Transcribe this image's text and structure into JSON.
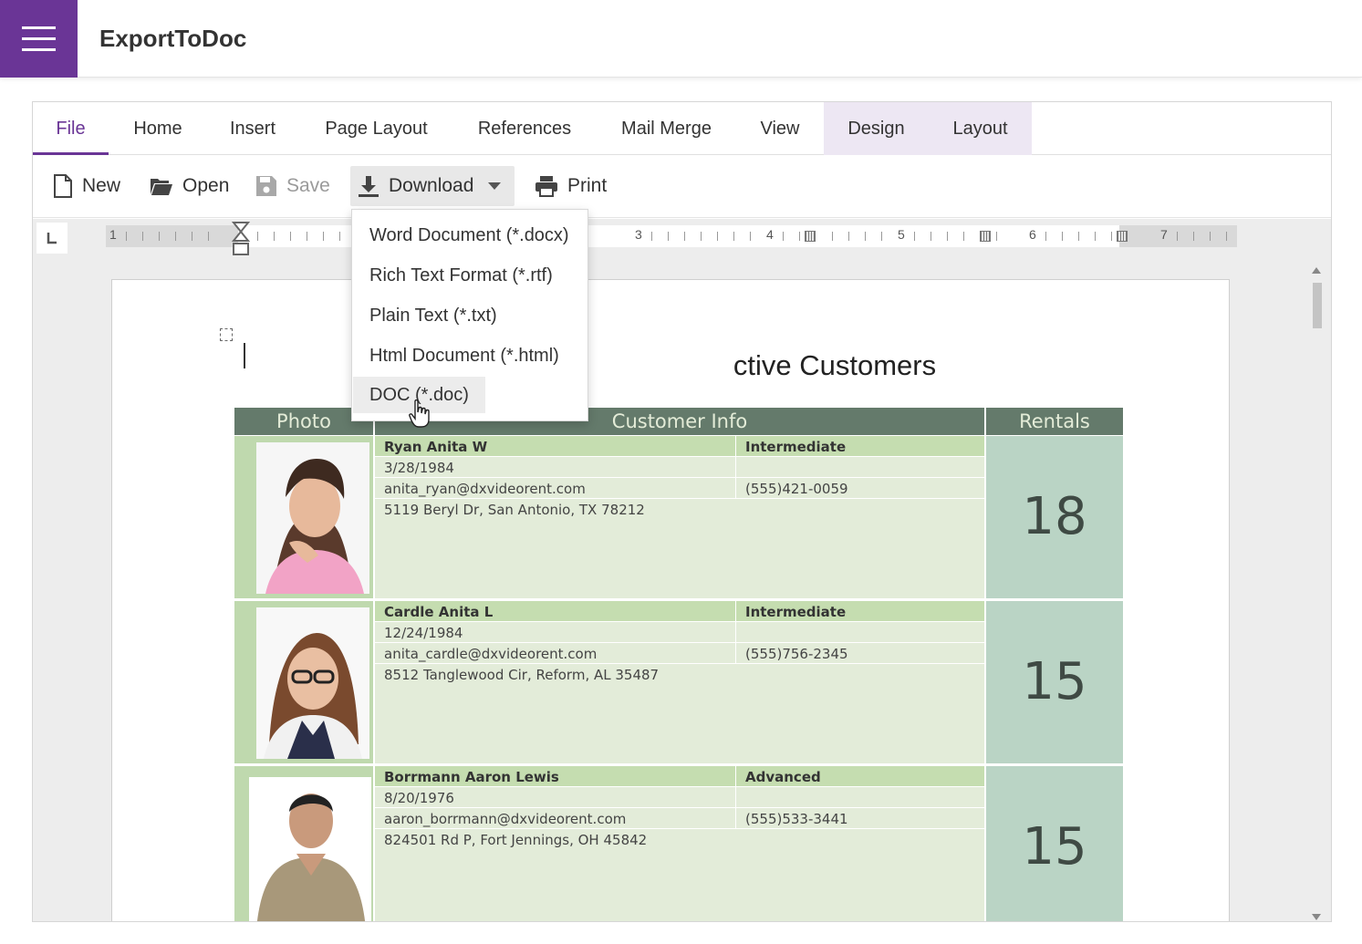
{
  "app": {
    "title": "ExportToDoc"
  },
  "tabs": [
    {
      "label": "File"
    },
    {
      "label": "Home"
    },
    {
      "label": "Insert"
    },
    {
      "label": "Page Layout"
    },
    {
      "label": "References"
    },
    {
      "label": "Mail Merge"
    },
    {
      "label": "View"
    },
    {
      "label": "Design"
    },
    {
      "label": "Layout"
    }
  ],
  "active_tab": "File",
  "toolbar": {
    "new_label": "New",
    "open_label": "Open",
    "save_label": "Save",
    "download_label": "Download",
    "print_label": "Print"
  },
  "download_menu": {
    "items": [
      {
        "label": "Word Document (*.docx)"
      },
      {
        "label": "Rich Text Format (*.rtf)"
      },
      {
        "label": "Plain Text (*.txt)"
      },
      {
        "label": "Html Document (*.html)"
      },
      {
        "label": "DOC (*.doc)"
      }
    ],
    "hovered": "DOC (*.doc)"
  },
  "ruler": {
    "numbers": [
      "1",
      "3",
      "4",
      "5",
      "6",
      "7"
    ]
  },
  "document": {
    "title": "ctive Customers",
    "table": {
      "headers": {
        "photo": "Photo",
        "info": "Customer Info",
        "rentals": "Rentals"
      },
      "rows": [
        {
          "name": "Ryan Anita W",
          "level": "Intermediate",
          "birth": "3/28/1984",
          "email": "anita_ryan@dxvideorent.com",
          "phone": "(555)421-0059",
          "address": "5119 Beryl Dr, San Antonio, TX 78212",
          "rentals": "18"
        },
        {
          "name": "Cardle Anita L",
          "level": "Intermediate",
          "birth": "12/24/1984",
          "email": "anita_cardle@dxvideorent.com",
          "phone": "(555)756-2345",
          "address": "8512 Tanglewood Cir,  Reform, AL 35487",
          "rentals": "15"
        },
        {
          "name": "Borrmann Aaron Lewis",
          "level": "Advanced",
          "birth": "8/20/1976",
          "email": "aaron_borrmann@dxvideorent.com",
          "phone": "(555)533-3441",
          "address": "824501 Rd P, Fort Jennings, OH 45842",
          "rentals": "15"
        }
      ]
    }
  },
  "colors": {
    "brand": "#6a3596",
    "table_header": "#647a6b",
    "photo_bg": "#bfd9ae",
    "info_bg": "#e3ecd9",
    "rentals_bg": "#bad4c5",
    "context_tab_bg": "#ede7f3"
  }
}
